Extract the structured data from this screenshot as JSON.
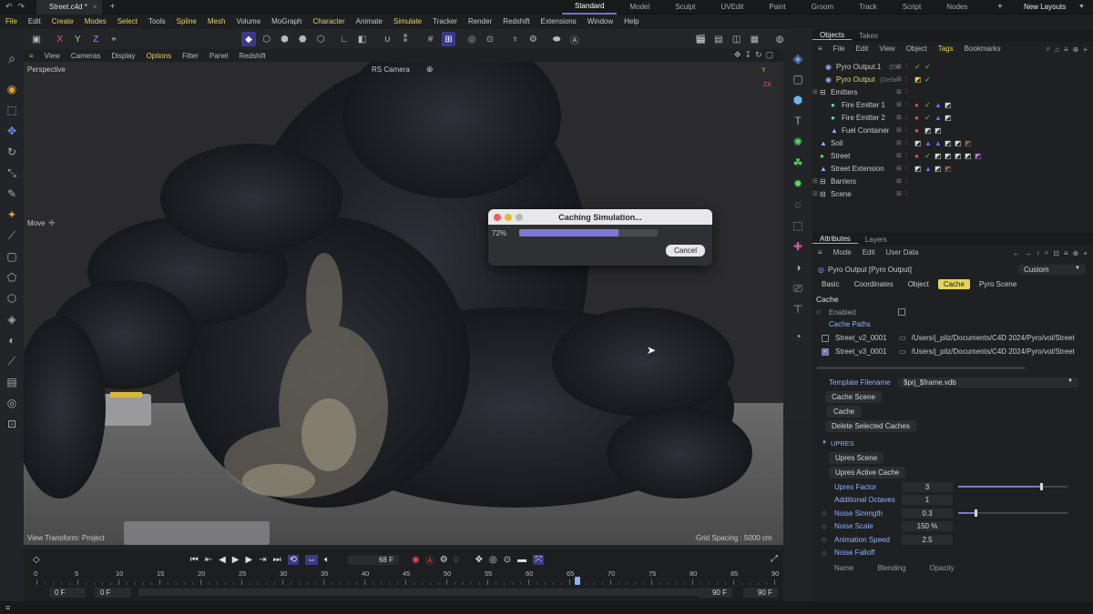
{
  "titlebar": {
    "doc_tab": "Street.c4d *",
    "layouts": [
      "Standard",
      "Model",
      "Sculpt",
      "UVEdit",
      "Paint",
      "Groom",
      "Track",
      "Script",
      "Nodes"
    ],
    "active_layout": "Standard",
    "new_layouts": "New Layouts"
  },
  "menubar": [
    "File",
    "Edit",
    "Create",
    "Modes",
    "Select",
    "Tools",
    "Spline",
    "Mesh",
    "Volume",
    "MoGraph",
    "Character",
    "Animate",
    "Simulate",
    "Tracker",
    "Render",
    "Redshift",
    "Extensions",
    "Window",
    "Help"
  ],
  "viewport": {
    "menu": [
      "View",
      "Cameras",
      "Display",
      "Options",
      "Filter",
      "Panel",
      "Redshift"
    ],
    "label_perspective": "Perspective",
    "camera": "RS Camera",
    "tool_label": "Move",
    "view_transform": "View Transform: Project",
    "grid_spacing": "Grid Spacing : 5000 cm",
    "axis_y": "Y",
    "axis_zx": "ZX"
  },
  "dialog": {
    "title": "Caching Simulation...",
    "percent_label": "72%",
    "progress": 0.72,
    "cancel": "Cancel"
  },
  "objects": {
    "tabs": [
      "Objects",
      "Takes"
    ],
    "menu": [
      "File",
      "Edit",
      "View",
      "Object",
      "Tags",
      "Bookmarks"
    ],
    "items": [
      {
        "name": "Pyro Output.1",
        "suffix": "(De",
        "indent": 1,
        "highlight": false,
        "icon": "pyro-icon"
      },
      {
        "name": "Pyro Output",
        "suffix": "(Defa",
        "indent": 1,
        "highlight": true,
        "icon": "pyro-icon"
      },
      {
        "name": "Emitters",
        "suffix": "",
        "indent": 0,
        "highlight": false,
        "icon": "null-icon"
      },
      {
        "name": "Fire Emitter 1",
        "suffix": "",
        "indent": 2,
        "highlight": false,
        "icon": "emitter-icon"
      },
      {
        "name": "Fire Emitter 2",
        "suffix": "",
        "indent": 2,
        "highlight": false,
        "icon": "emitter-icon"
      },
      {
        "name": "Fuel Container",
        "suffix": "",
        "indent": 2,
        "highlight": false,
        "icon": "container-icon"
      },
      {
        "name": "Soil",
        "suffix": "",
        "indent": 0,
        "highlight": false,
        "icon": "soil-icon"
      },
      {
        "name": "Street",
        "suffix": "",
        "indent": 0,
        "highlight": false,
        "icon": "street-icon"
      },
      {
        "name": "Street Extension",
        "suffix": "",
        "indent": 0,
        "highlight": false,
        "icon": "extension-icon"
      },
      {
        "name": "Barriers",
        "suffix": "",
        "indent": 0,
        "highlight": false,
        "icon": "null-icon"
      },
      {
        "name": "Scene",
        "suffix": "",
        "indent": 0,
        "highlight": false,
        "icon": "null-icon"
      }
    ]
  },
  "attributes": {
    "tabs": [
      "Attributes",
      "Layers"
    ],
    "menu": [
      "Mode",
      "Edit",
      "User Data"
    ],
    "object_title": "Pyro Output [Pyro Output]",
    "preset": "Custom",
    "sub_tabs": [
      "Basic",
      "Coordinates",
      "Object",
      "Cache",
      "Pyro Scene"
    ],
    "active_sub_tab": "Cache",
    "section_cache": "Cache",
    "enabled_label": "Enabled",
    "cache_paths_label": "Cache Paths",
    "cache_rows": [
      {
        "name": "Street_v2_0001",
        "path": "/Users/j_pilz/Documents/C4D 2024/Pyro/vol/Street",
        "checked": false
      },
      {
        "name": "Street_v3_0001",
        "path": "/Users/j_pilz/Documents/C4D 2024/Pyro/vol/Street",
        "checked": true
      }
    ],
    "template_label": "Template Filename",
    "template_value": "$prj_$frame.vdb",
    "cache_scene_btn": "Cache Scene",
    "cache_btn": "Cache",
    "delete_btn": "Delete Selected Caches",
    "upres_section": "UPRES",
    "upres_scene_btn": "Upres Scene",
    "upres_active_btn": "Upres Active Cache",
    "params": [
      {
        "label": "Upres Factor",
        "value": "3",
        "slider": 0.75
      },
      {
        "label": "Additional Octaves",
        "value": "1",
        "slider": null
      },
      {
        "label": "Noise Strength",
        "value": "0.3",
        "slider": 0.15
      },
      {
        "label": "Noise Scale",
        "value": "150 %",
        "slider": null
      },
      {
        "label": "Animation Speed",
        "value": "2.5",
        "slider": null
      },
      {
        "label": "Noise Falloff",
        "value": "",
        "slider": null
      }
    ],
    "table_headers": [
      "Name",
      "Blending",
      "Opacity"
    ]
  },
  "timeline": {
    "current_frame": "68 F",
    "ticks": [
      "0",
      "5",
      "10",
      "15",
      "20",
      "25",
      "30",
      "35",
      "40",
      "45",
      "50",
      "55",
      "60",
      "65",
      "70",
      "75",
      "80",
      "85",
      "90"
    ],
    "start": "0 F",
    "start2": "0 F",
    "end": "90 F",
    "end2": "90 F",
    "playhead_frame": 66,
    "max_frame": 90
  }
}
